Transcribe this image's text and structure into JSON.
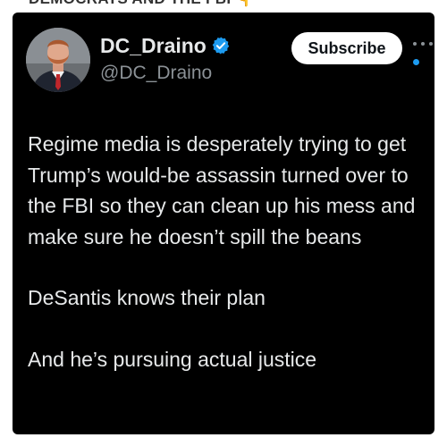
{
  "header_strip": {
    "text": "DEMOCRATS AND THE FBI",
    "emoji": "👇"
  },
  "post": {
    "author": {
      "display_name": "DC_Draino",
      "handle": "@DC_Draino",
      "verified": true
    },
    "subscribe_label": "Subscribe",
    "paragraphs": [
      "Regime media is desperately trying to get Trump’s would-be assassin turned over to the FBI so they can clean up his mess and make sure he doesn’t spill the beans",
      "DeSantis knows their plan",
      "And he’s pursuing actual justice"
    ]
  },
  "colors": {
    "card_background": "#000000",
    "text": "#e7e9ea",
    "secondary_text": "#8b9196",
    "verified_badge": "#1d9bf0",
    "subscribe_button": "#ffffff"
  },
  "icons": [
    "verified-badge-icon",
    "more-options-icon"
  ]
}
